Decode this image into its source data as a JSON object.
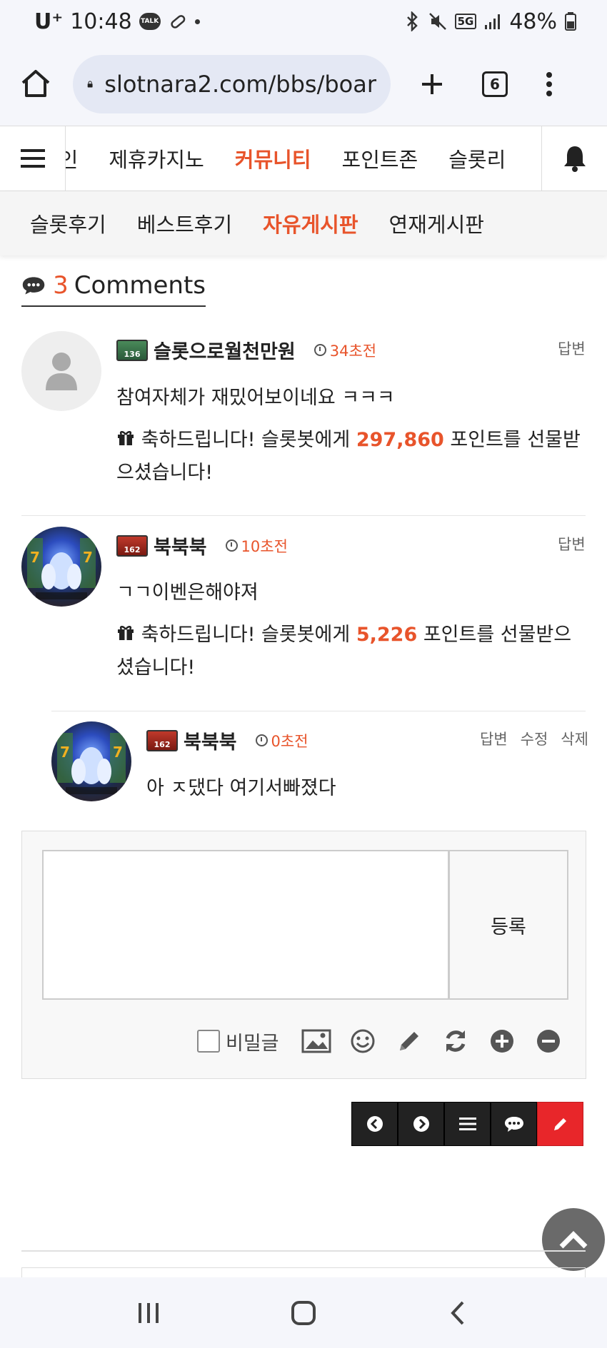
{
  "status_bar": {
    "carrier": "U⁺",
    "time": "10:48",
    "talk_badge": "TALK",
    "network": "5G",
    "battery": "48%"
  },
  "browser": {
    "url": "slotnara2.com/bbs/boar",
    "tab_count": "6"
  },
  "main_nav": {
    "items": [
      "메인",
      "제휴카지노",
      "커뮤니티",
      "포인트존",
      "슬롯리"
    ],
    "active": "커뮤니티"
  },
  "sub_nav": {
    "items": [
      "슬롯후기",
      "베스트후기",
      "자유게시판",
      "연재게시판"
    ],
    "active": "자유게시판"
  },
  "comments_header": {
    "count": "3",
    "label": "Comments"
  },
  "comments": [
    {
      "level": "136",
      "author": "슬롯으로월천만원",
      "time": "34초전",
      "actions": [
        "답변"
      ],
      "text": "참여자체가 재밌어보이네요 ㅋㅋㅋ",
      "gift_prefix": "축하드립니다! 슬롯봇에게 ",
      "gift_points": "297,860",
      "gift_suffix": " 포인트를 선물받으셨습니다!"
    },
    {
      "level": "162",
      "author": "북북북",
      "time": "10초전",
      "actions": [
        "답변"
      ],
      "text": "ㄱㄱ이벤은해야져",
      "gift_prefix": "축하드립니다! 슬롯봇에게 ",
      "gift_points": "5,226",
      "gift_suffix": " 포인트를 선물받으셨습니다!"
    },
    {
      "level": "162",
      "author": "북북북",
      "time": "0초전",
      "actions": [
        "답변",
        "수정",
        "삭제"
      ],
      "text": "아 ㅈ댔다 여기서빠졌다"
    }
  ],
  "comment_form": {
    "submit_label": "등록",
    "secret_label": "비밀글"
  },
  "colors": {
    "accent": "#e8542b",
    "write_button": "#e8262a"
  }
}
